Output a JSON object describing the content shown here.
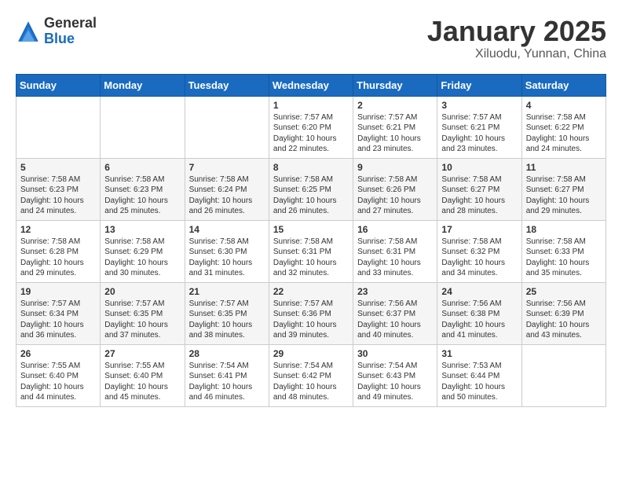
{
  "header": {
    "logo_general": "General",
    "logo_blue": "Blue",
    "title": "January 2025",
    "subtitle": "Xiluodu, Yunnan, China"
  },
  "days_of_week": [
    "Sunday",
    "Monday",
    "Tuesday",
    "Wednesday",
    "Thursday",
    "Friday",
    "Saturday"
  ],
  "weeks": [
    [
      {
        "day": "",
        "info": ""
      },
      {
        "day": "",
        "info": ""
      },
      {
        "day": "",
        "info": ""
      },
      {
        "day": "1",
        "info": "Sunrise: 7:57 AM\nSunset: 6:20 PM\nDaylight: 10 hours\nand 22 minutes."
      },
      {
        "day": "2",
        "info": "Sunrise: 7:57 AM\nSunset: 6:21 PM\nDaylight: 10 hours\nand 23 minutes."
      },
      {
        "day": "3",
        "info": "Sunrise: 7:57 AM\nSunset: 6:21 PM\nDaylight: 10 hours\nand 23 minutes."
      },
      {
        "day": "4",
        "info": "Sunrise: 7:58 AM\nSunset: 6:22 PM\nDaylight: 10 hours\nand 24 minutes."
      }
    ],
    [
      {
        "day": "5",
        "info": "Sunrise: 7:58 AM\nSunset: 6:23 PM\nDaylight: 10 hours\nand 24 minutes."
      },
      {
        "day": "6",
        "info": "Sunrise: 7:58 AM\nSunset: 6:23 PM\nDaylight: 10 hours\nand 25 minutes."
      },
      {
        "day": "7",
        "info": "Sunrise: 7:58 AM\nSunset: 6:24 PM\nDaylight: 10 hours\nand 26 minutes."
      },
      {
        "day": "8",
        "info": "Sunrise: 7:58 AM\nSunset: 6:25 PM\nDaylight: 10 hours\nand 26 minutes."
      },
      {
        "day": "9",
        "info": "Sunrise: 7:58 AM\nSunset: 6:26 PM\nDaylight: 10 hours\nand 27 minutes."
      },
      {
        "day": "10",
        "info": "Sunrise: 7:58 AM\nSunset: 6:27 PM\nDaylight: 10 hours\nand 28 minutes."
      },
      {
        "day": "11",
        "info": "Sunrise: 7:58 AM\nSunset: 6:27 PM\nDaylight: 10 hours\nand 29 minutes."
      }
    ],
    [
      {
        "day": "12",
        "info": "Sunrise: 7:58 AM\nSunset: 6:28 PM\nDaylight: 10 hours\nand 29 minutes."
      },
      {
        "day": "13",
        "info": "Sunrise: 7:58 AM\nSunset: 6:29 PM\nDaylight: 10 hours\nand 30 minutes."
      },
      {
        "day": "14",
        "info": "Sunrise: 7:58 AM\nSunset: 6:30 PM\nDaylight: 10 hours\nand 31 minutes."
      },
      {
        "day": "15",
        "info": "Sunrise: 7:58 AM\nSunset: 6:31 PM\nDaylight: 10 hours\nand 32 minutes."
      },
      {
        "day": "16",
        "info": "Sunrise: 7:58 AM\nSunset: 6:31 PM\nDaylight: 10 hours\nand 33 minutes."
      },
      {
        "day": "17",
        "info": "Sunrise: 7:58 AM\nSunset: 6:32 PM\nDaylight: 10 hours\nand 34 minutes."
      },
      {
        "day": "18",
        "info": "Sunrise: 7:58 AM\nSunset: 6:33 PM\nDaylight: 10 hours\nand 35 minutes."
      }
    ],
    [
      {
        "day": "19",
        "info": "Sunrise: 7:57 AM\nSunset: 6:34 PM\nDaylight: 10 hours\nand 36 minutes."
      },
      {
        "day": "20",
        "info": "Sunrise: 7:57 AM\nSunset: 6:35 PM\nDaylight: 10 hours\nand 37 minutes."
      },
      {
        "day": "21",
        "info": "Sunrise: 7:57 AM\nSunset: 6:35 PM\nDaylight: 10 hours\nand 38 minutes."
      },
      {
        "day": "22",
        "info": "Sunrise: 7:57 AM\nSunset: 6:36 PM\nDaylight: 10 hours\nand 39 minutes."
      },
      {
        "day": "23",
        "info": "Sunrise: 7:56 AM\nSunset: 6:37 PM\nDaylight: 10 hours\nand 40 minutes."
      },
      {
        "day": "24",
        "info": "Sunrise: 7:56 AM\nSunset: 6:38 PM\nDaylight: 10 hours\nand 41 minutes."
      },
      {
        "day": "25",
        "info": "Sunrise: 7:56 AM\nSunset: 6:39 PM\nDaylight: 10 hours\nand 43 minutes."
      }
    ],
    [
      {
        "day": "26",
        "info": "Sunrise: 7:55 AM\nSunset: 6:40 PM\nDaylight: 10 hours\nand 44 minutes."
      },
      {
        "day": "27",
        "info": "Sunrise: 7:55 AM\nSunset: 6:40 PM\nDaylight: 10 hours\nand 45 minutes."
      },
      {
        "day": "28",
        "info": "Sunrise: 7:54 AM\nSunset: 6:41 PM\nDaylight: 10 hours\nand 46 minutes."
      },
      {
        "day": "29",
        "info": "Sunrise: 7:54 AM\nSunset: 6:42 PM\nDaylight: 10 hours\nand 48 minutes."
      },
      {
        "day": "30",
        "info": "Sunrise: 7:54 AM\nSunset: 6:43 PM\nDaylight: 10 hours\nand 49 minutes."
      },
      {
        "day": "31",
        "info": "Sunrise: 7:53 AM\nSunset: 6:44 PM\nDaylight: 10 hours\nand 50 minutes."
      },
      {
        "day": "",
        "info": ""
      }
    ]
  ]
}
